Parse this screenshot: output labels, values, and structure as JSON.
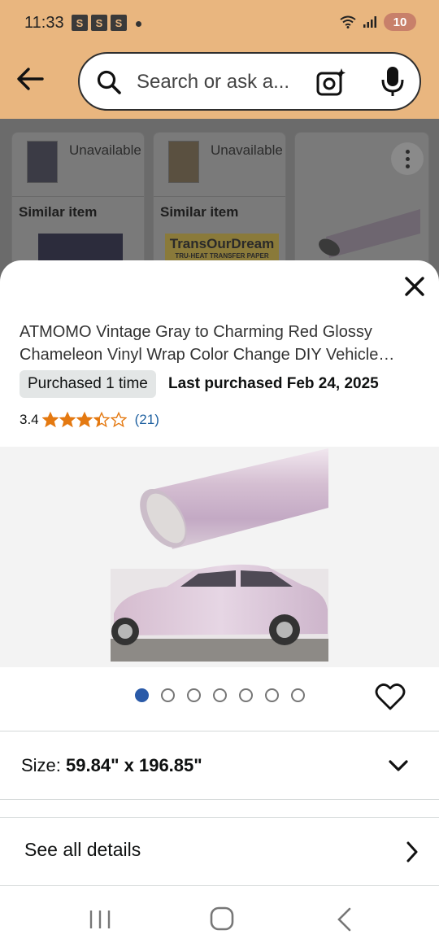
{
  "status_bar": {
    "time": "11:33",
    "badges": [
      "S",
      "S",
      "S"
    ],
    "battery": "10"
  },
  "header": {
    "search_placeholder": "Search or ask a...",
    "icons": [
      "back-arrow-icon",
      "search-icon",
      "camera-lens-icon",
      "microphone-icon"
    ]
  },
  "background_list": {
    "cards": [
      {
        "status": "Unavailable",
        "label": "Similar item"
      },
      {
        "status": "Unavailable",
        "label": "Similar item",
        "banner_title": "TransOurDream",
        "banner_sub": "TRU-HEAT TRANSFER PAPER"
      },
      {
        "status": "",
        "label": ""
      }
    ]
  },
  "sheet": {
    "title_line1": "ATMOMO Vintage Gray to Charming Red Glossy",
    "title_line2": "Chameleon Vinyl Wrap Color Change DIY Vehicle…",
    "purchased_badge": "Purchased 1 time",
    "last_purchased": "Last purchased Feb 24, 2025",
    "rating_value": "3.4",
    "rating_stars": 3.4,
    "rating_count": "(21)",
    "gallery": {
      "image_count": 7,
      "active_index": 0
    },
    "size_label": "Size: ",
    "size_value": "59.84\" x 196.85\"",
    "see_all_details": "See all details"
  },
  "colors": {
    "header_bg": "#e9b67f",
    "star": "#e47911",
    "link": "#2162a1",
    "active_dot": "#2a5aa8"
  }
}
